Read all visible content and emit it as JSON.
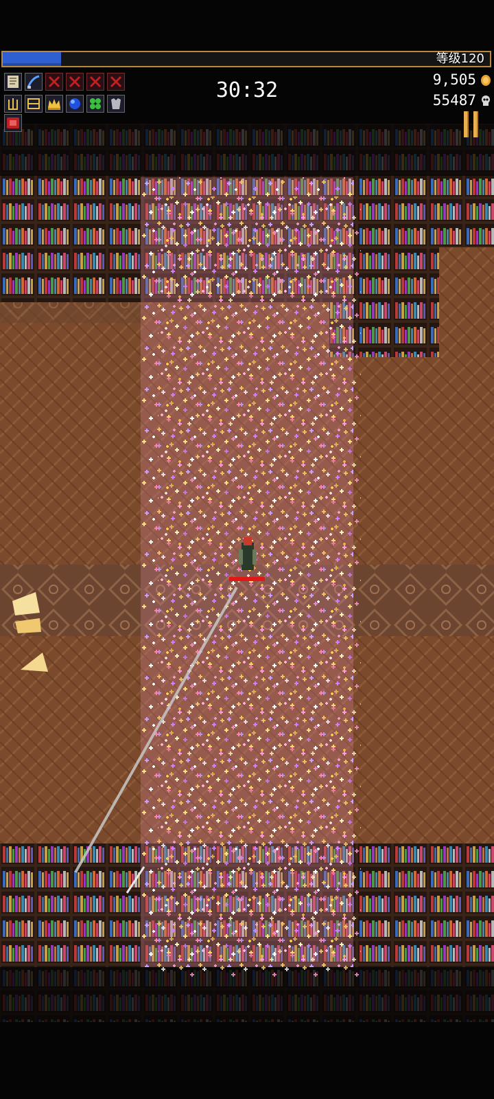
{
  "hud": {
    "level_label": "等级120",
    "xp_progress": 0.12,
    "timer": "30:32",
    "gold": "9,505",
    "kills": "55487"
  },
  "weapons": [
    {
      "name": "empty-tome-icon"
    },
    {
      "name": "whip-icon"
    },
    {
      "name": "empty-slot-icon"
    },
    {
      "name": "empty-slot-icon"
    },
    {
      "name": "empty-slot-icon"
    },
    {
      "name": "empty-slot-icon"
    }
  ],
  "passives": [
    {
      "name": "candelabrador-icon"
    },
    {
      "name": "spellbinder-icon"
    },
    {
      "name": "crown-icon"
    },
    {
      "name": "orb-icon"
    },
    {
      "name": "clover-icon"
    },
    {
      "name": "armor-icon"
    }
  ],
  "extra_items": [
    {
      "name": "red-relic-icon"
    }
  ],
  "colors": {
    "xp_fill": "#2f5fd0",
    "floor": "#7a4a2a",
    "gold_accent": "#e8b050"
  }
}
